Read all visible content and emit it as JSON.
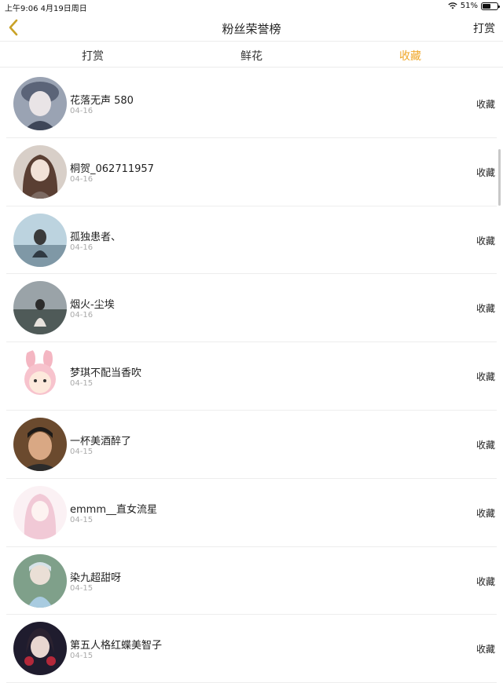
{
  "status_bar": {
    "time_date": "上午9:06   4月19日周日",
    "battery_pct": "51%"
  },
  "nav": {
    "title": "粉丝荣誉榜",
    "action": "打赏"
  },
  "tabs": [
    {
      "label": "打赏",
      "active": false
    },
    {
      "label": "鲜花",
      "active": false
    },
    {
      "label": "收藏",
      "active": true
    }
  ],
  "colors": {
    "accent": "#f0a82a"
  },
  "rows": [
    {
      "name": "花落无声 580",
      "date": "04-16",
      "action": "收藏"
    },
    {
      "name": "桐贺_062711957",
      "date": "04-16",
      "action": "收藏"
    },
    {
      "name": "孤独患者、",
      "date": "04-16",
      "action": "收藏"
    },
    {
      "name": "烟火-尘埃",
      "date": "04-16",
      "action": "收藏"
    },
    {
      "name": "梦琪不配当香吹",
      "date": "04-15",
      "action": "收藏"
    },
    {
      "name": "一杯美酒醉了",
      "date": "04-15",
      "action": "收藏"
    },
    {
      "name": "emmm__直女流星",
      "date": "04-15",
      "action": "收藏"
    },
    {
      "name": "染九超甜呀",
      "date": "04-15",
      "action": "收藏"
    },
    {
      "name": "第五人格红蝶美智子",
      "date": "04-15",
      "action": "收藏"
    }
  ]
}
